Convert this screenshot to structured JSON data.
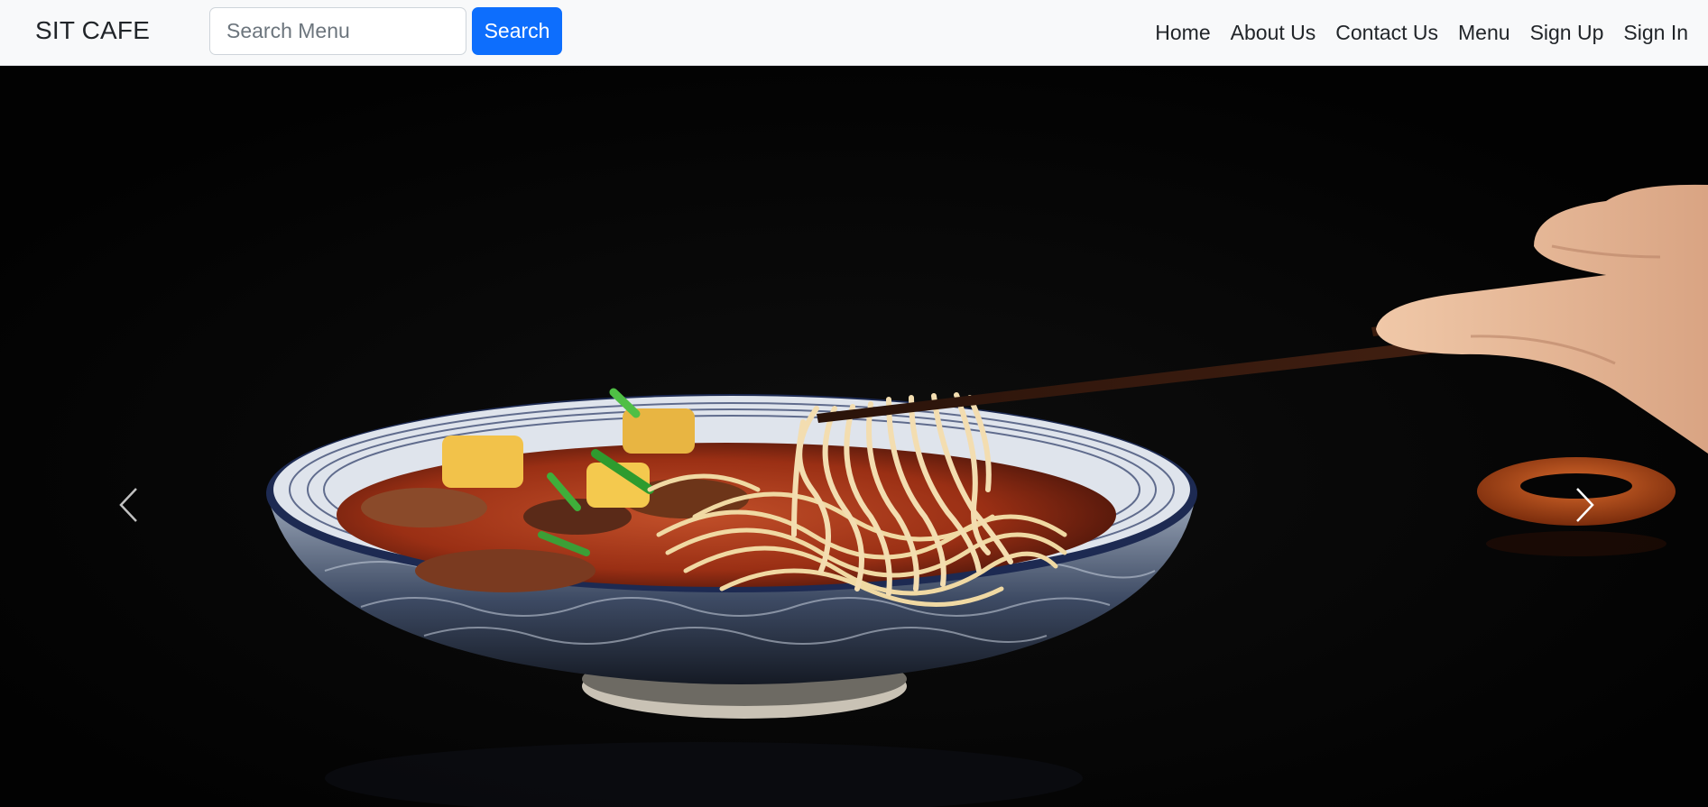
{
  "navbar": {
    "brand": "SIT CAFE",
    "search": {
      "placeholder": "Search Menu",
      "value": "",
      "button_label": "Search"
    },
    "links": [
      "Home",
      "About Us",
      "Contact Us",
      "Menu",
      "Sign Up",
      "Sign In"
    ]
  },
  "carousel": {
    "slide_icon": "noodle-bowl-photo",
    "prev_icon": "chevron-left-icon",
    "next_icon": "chevron-right-icon"
  },
  "colors": {
    "navbar_bg": "#f8f9fa",
    "primary": "#0d6efd",
    "hero_bg": "#000000"
  }
}
